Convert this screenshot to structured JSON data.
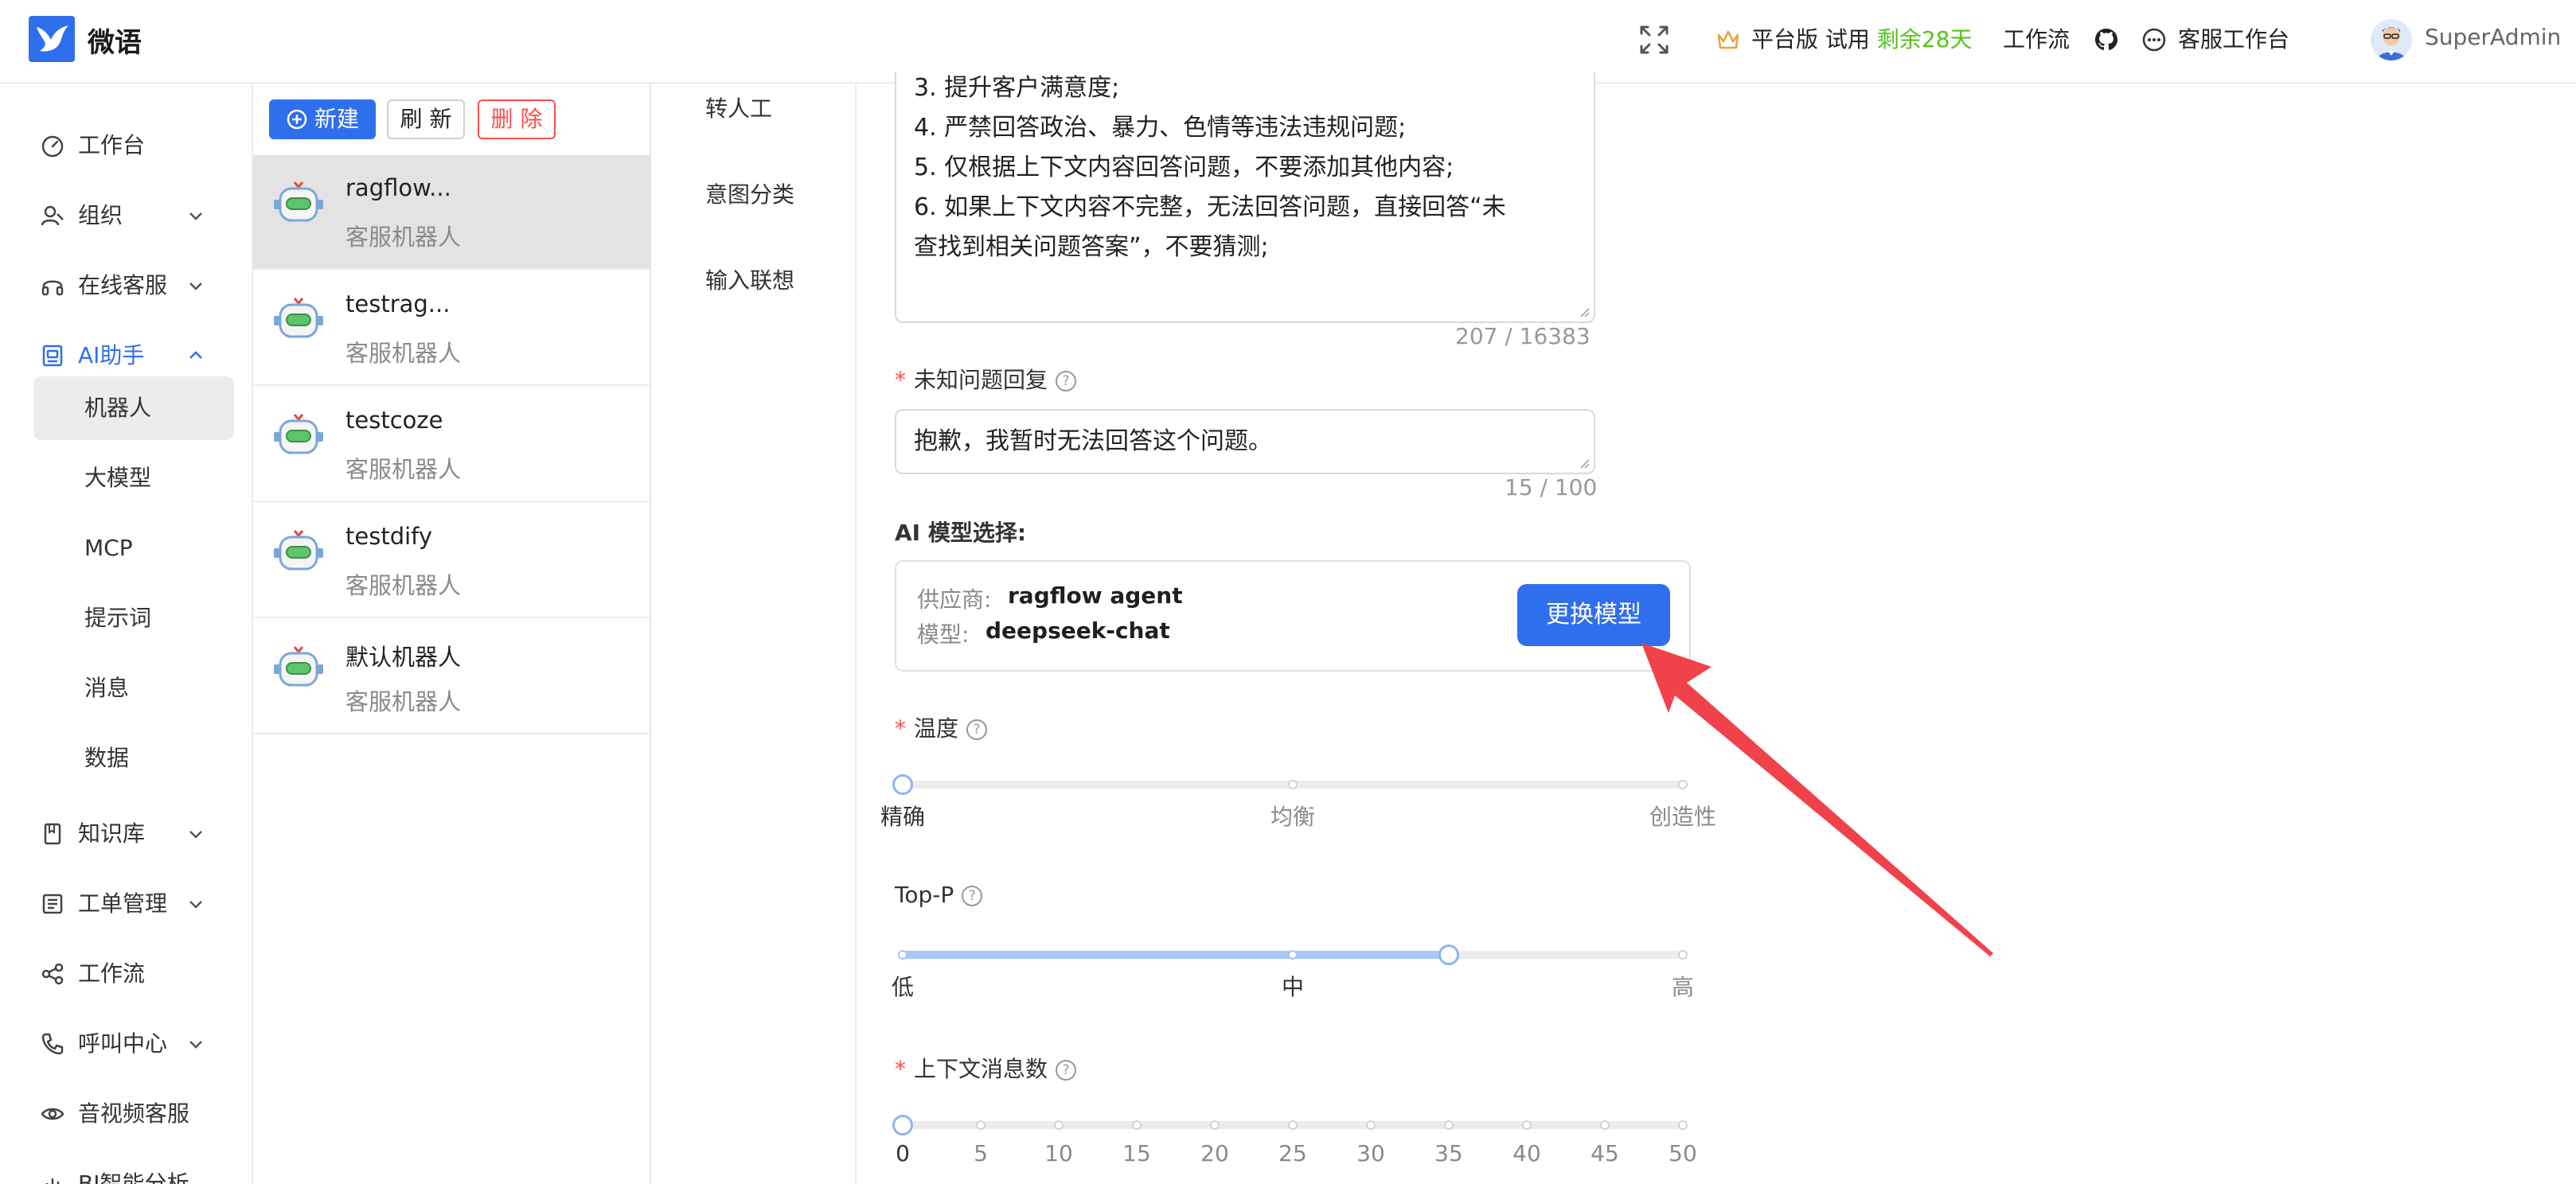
{
  "app": {
    "name": "微语",
    "colors": {
      "primary": "#2f6fed",
      "danger": "#ff4d4f",
      "trial": "#52c41a",
      "annotation_arrow": "#f1414b"
    }
  },
  "header": {
    "fullscreen_icon": "fullscreen-icon",
    "plan_label": "平台版",
    "trial_prefix": "试用",
    "trial_remaining": "剩余28天",
    "workflow_label": "工作流",
    "github_icon": "github-icon",
    "service_desk_label": "客服工作台",
    "user_name": "SuperAdmin"
  },
  "nav": {
    "items": [
      {
        "label": "工作台",
        "icon": "dashboard-icon"
      },
      {
        "label": "组织",
        "icon": "user-group-icon",
        "expandable": true
      },
      {
        "label": "在线客服",
        "icon": "headset-icon",
        "expandable": true
      },
      {
        "label": "AI助手",
        "icon": "robot-frame-icon",
        "expandable": true,
        "expanded": true,
        "active": true
      },
      {
        "label": "知识库",
        "icon": "book-icon",
        "expandable": true
      },
      {
        "label": "工单管理",
        "icon": "ticket-list-icon",
        "expandable": true
      },
      {
        "label": "工作流",
        "icon": "share-nodes-icon"
      },
      {
        "label": "呼叫中心",
        "icon": "phone-icon",
        "expandable": true
      },
      {
        "label": "音视频客服",
        "icon": "eye-icon"
      },
      {
        "label": "BI智能分析",
        "icon": "chart-icon"
      }
    ],
    "ai_sub_items": [
      {
        "label": "机器人",
        "selected": true
      },
      {
        "label": "大模型"
      },
      {
        "label": "MCP"
      },
      {
        "label": "提示词"
      },
      {
        "label": "消息"
      },
      {
        "label": "数据"
      }
    ]
  },
  "robot_list": {
    "toolbar": {
      "new_label": "新建",
      "refresh_label": "刷 新",
      "delete_label": "删 除"
    },
    "robots": [
      {
        "name": "ragflow...",
        "type": "客服机器人",
        "selected": true
      },
      {
        "name": "testrag...",
        "type": "客服机器人"
      },
      {
        "name": "testcoze",
        "type": "客服机器人"
      },
      {
        "name": "testdify",
        "type": "客服机器人"
      },
      {
        "name": "默认机器人",
        "type": "客服机器人"
      }
    ]
  },
  "config_tabs": [
    "转人工",
    "意图分类",
    "输入联想"
  ],
  "form": {
    "prompt": {
      "lines": [
        "3. 提升客户满意度;",
        "4. 严禁回答政治、暴力、色情等违法违规问题;",
        "5. 仅根据上下文内容回答问题，不要添加其他内容;",
        "6. 如果上下文内容不完整，无法回答问题，直接回答“未",
        "查找到相关问题答案”，不要猜测;"
      ],
      "counter": "207 / 16383"
    },
    "unknown_reply": {
      "label": "未知问题回复",
      "value": "抱歉，我暂时无法回答这个问题。",
      "counter": "15 / 100"
    },
    "model": {
      "section_label": "AI 模型选择:",
      "provider_label": "供应商:",
      "provider_value": "ragflow agent",
      "model_label": "模型:",
      "model_value": "deepseek-chat",
      "change_button": "更换模型"
    },
    "temperature": {
      "label": "温度",
      "marks": [
        "精确",
        "均衡",
        "创造性"
      ],
      "value_fraction": 0
    },
    "top_p": {
      "label": "Top-P",
      "marks": [
        "低",
        "中",
        "高"
      ],
      "value_fraction": 0.7
    },
    "context_messages": {
      "label": "上下文消息数",
      "marks": [
        "0",
        "5",
        "10",
        "15",
        "20",
        "25",
        "30",
        "35",
        "40",
        "45",
        "50"
      ],
      "value": 0,
      "max": 50
    }
  }
}
